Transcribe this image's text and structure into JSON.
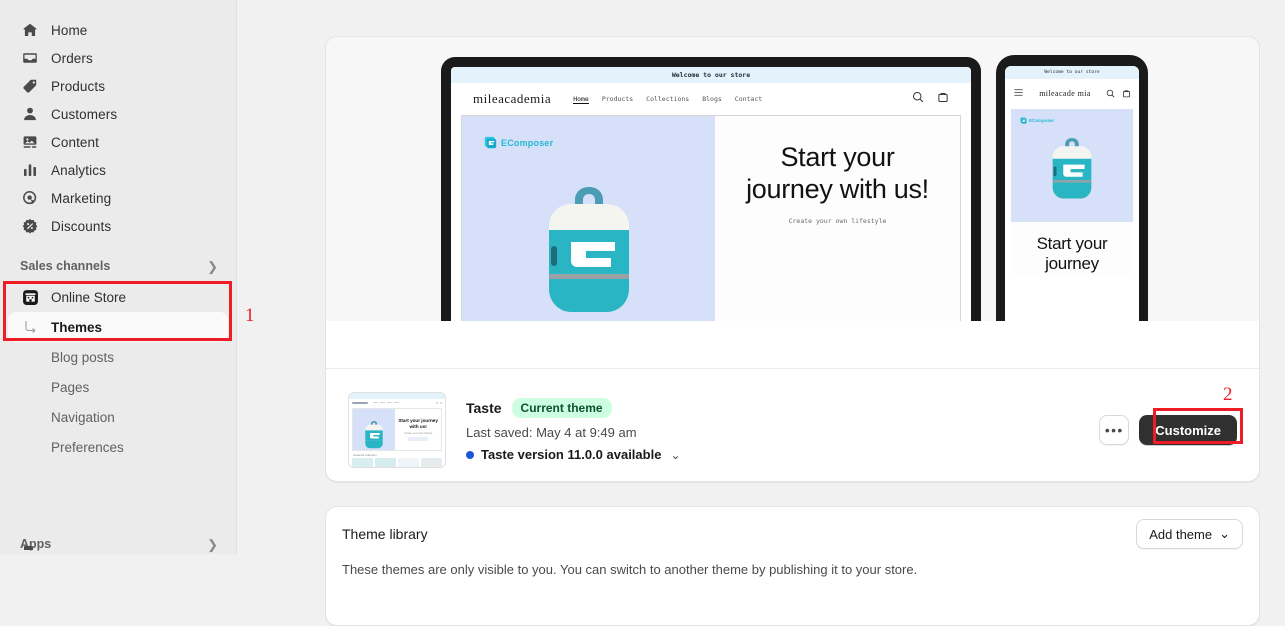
{
  "sidebar": {
    "nav": [
      {
        "label": "Home",
        "icon": "home-icon"
      },
      {
        "label": "Orders",
        "icon": "orders-inbox-icon"
      },
      {
        "label": "Products",
        "icon": "products-tag-icon"
      },
      {
        "label": "Customers",
        "icon": "customers-person-icon"
      },
      {
        "label": "Content",
        "icon": "content-image-icon"
      },
      {
        "label": "Analytics",
        "icon": "analytics-bars-icon"
      },
      {
        "label": "Marketing",
        "icon": "marketing-target-icon"
      },
      {
        "label": "Discounts",
        "icon": "discounts-percent-icon"
      }
    ],
    "sales_channels": {
      "label": "Sales channels",
      "chevron": "chevron-right-icon"
    },
    "online_store": {
      "label": "Online Store",
      "icon": "storefront-icon"
    },
    "store_pages": [
      {
        "label": "Themes",
        "selected": true
      },
      {
        "label": "Blog posts",
        "selected": false
      },
      {
        "label": "Pages",
        "selected": false
      },
      {
        "label": "Navigation",
        "selected": false
      },
      {
        "label": "Preferences",
        "selected": false
      }
    ],
    "apps": {
      "label": "Apps",
      "chevron": "chevron-right-icon"
    }
  },
  "annotations": [
    {
      "number": "1",
      "target": "online-store-themes-nav",
      "color": "#ee1c24"
    },
    {
      "number": "2",
      "target": "customize-button",
      "color": "#ee1c24"
    }
  ],
  "preview": {
    "desktop": {
      "announcement": "Welcome to our store",
      "brand": "mileacademia",
      "nav": [
        "Home",
        "Products",
        "Collections",
        "Blogs",
        "Contact"
      ],
      "active_nav": "Home",
      "search_icon": "search-icon",
      "cart_icon": "cart-icon",
      "badge": "EComposer",
      "heading": "Start your journey with us!",
      "subheading": "Create your own lifestyle"
    },
    "mobile": {
      "announcement": "Welcome to our store",
      "brand": "mileacade mia",
      "menu_icon": "hamburger-menu-icon",
      "search_icon": "search-icon",
      "cart_icon": "cart-icon",
      "badge": "EComposer",
      "heading": "Start your journey"
    }
  },
  "theme_row": {
    "thumbnail_alt": "Taste theme preview thumbnail",
    "name": "Taste",
    "badge": "Current theme",
    "last_saved": "Last saved: May 4 at 9:49 am",
    "version_notice": "Taste version 11.0.0 available",
    "version_dot_color": "#1c56d6",
    "version_chevron": "chevron-down-icon",
    "more_actions": "•••",
    "customize_label": "Customize"
  },
  "theme_library": {
    "title": "Theme library",
    "add_theme_label": "Add theme",
    "add_theme_chevron": "chevron-down-icon",
    "description": "These themes are only visible to you. You can switch to another theme by publishing it to your store."
  },
  "colors": {
    "sidebar_bg": "#ebebeb",
    "page_bg": "#f1f1f1",
    "card_bg": "#ffffff",
    "preview_bg": "#f7f7f7",
    "badge_bg": "#cdfee1",
    "badge_text": "#0c5132",
    "primary_button": "#303030",
    "annotation": "#ee1c24",
    "brand_teal": "#22b8d4",
    "hero_bg": "#d6e0f8"
  }
}
